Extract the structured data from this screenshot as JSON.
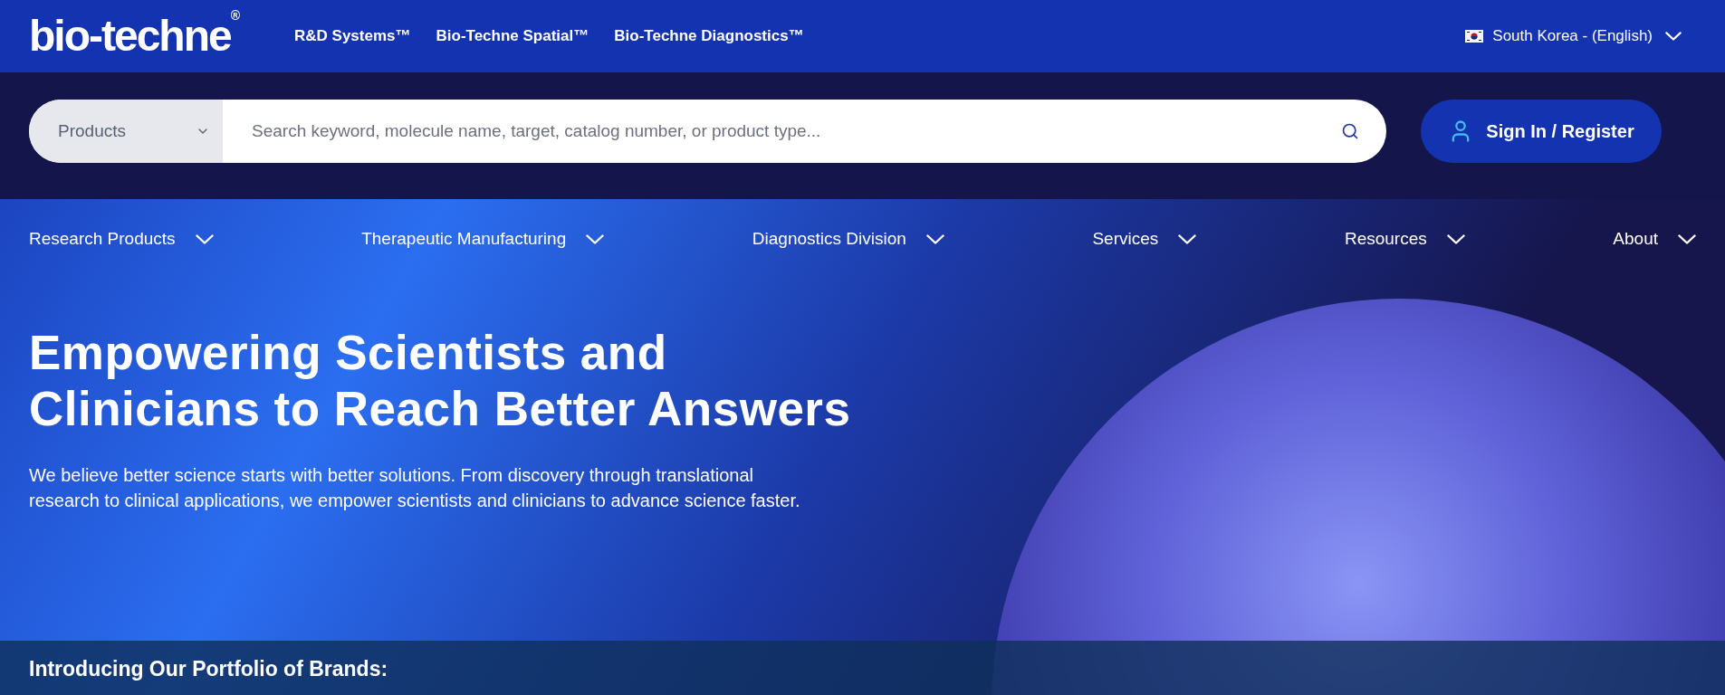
{
  "header": {
    "logo": "bio-techne$^{®}$",
    "brand_links": [
      "R&D Systems™",
      "Bio-Techne Spatial™",
      "Bio-Techne Diagnostics™"
    ],
    "region": "South Korea - (English)"
  },
  "search": {
    "category": "Products",
    "placeholder": "Search keyword, molecule name, target, catalog number, or product type...",
    "sign_in": "Sign In / Register"
  },
  "nav": [
    "Research Products",
    "Therapeutic Manufacturing",
    "Diagnostics Division",
    "Services",
    "Resources",
    "About"
  ],
  "hero": {
    "title_lines": [
      "Empowering Scientists and",
      "Clinicians to Reach Better Answers"
    ],
    "text": "We believe better science starts with better solutions. From discovery through translational research to clinical applications, we empower scientists and clinicians to advance science faster."
  },
  "brands_band": {
    "title": "Introducing Our Portfolio of Brands:"
  }
}
